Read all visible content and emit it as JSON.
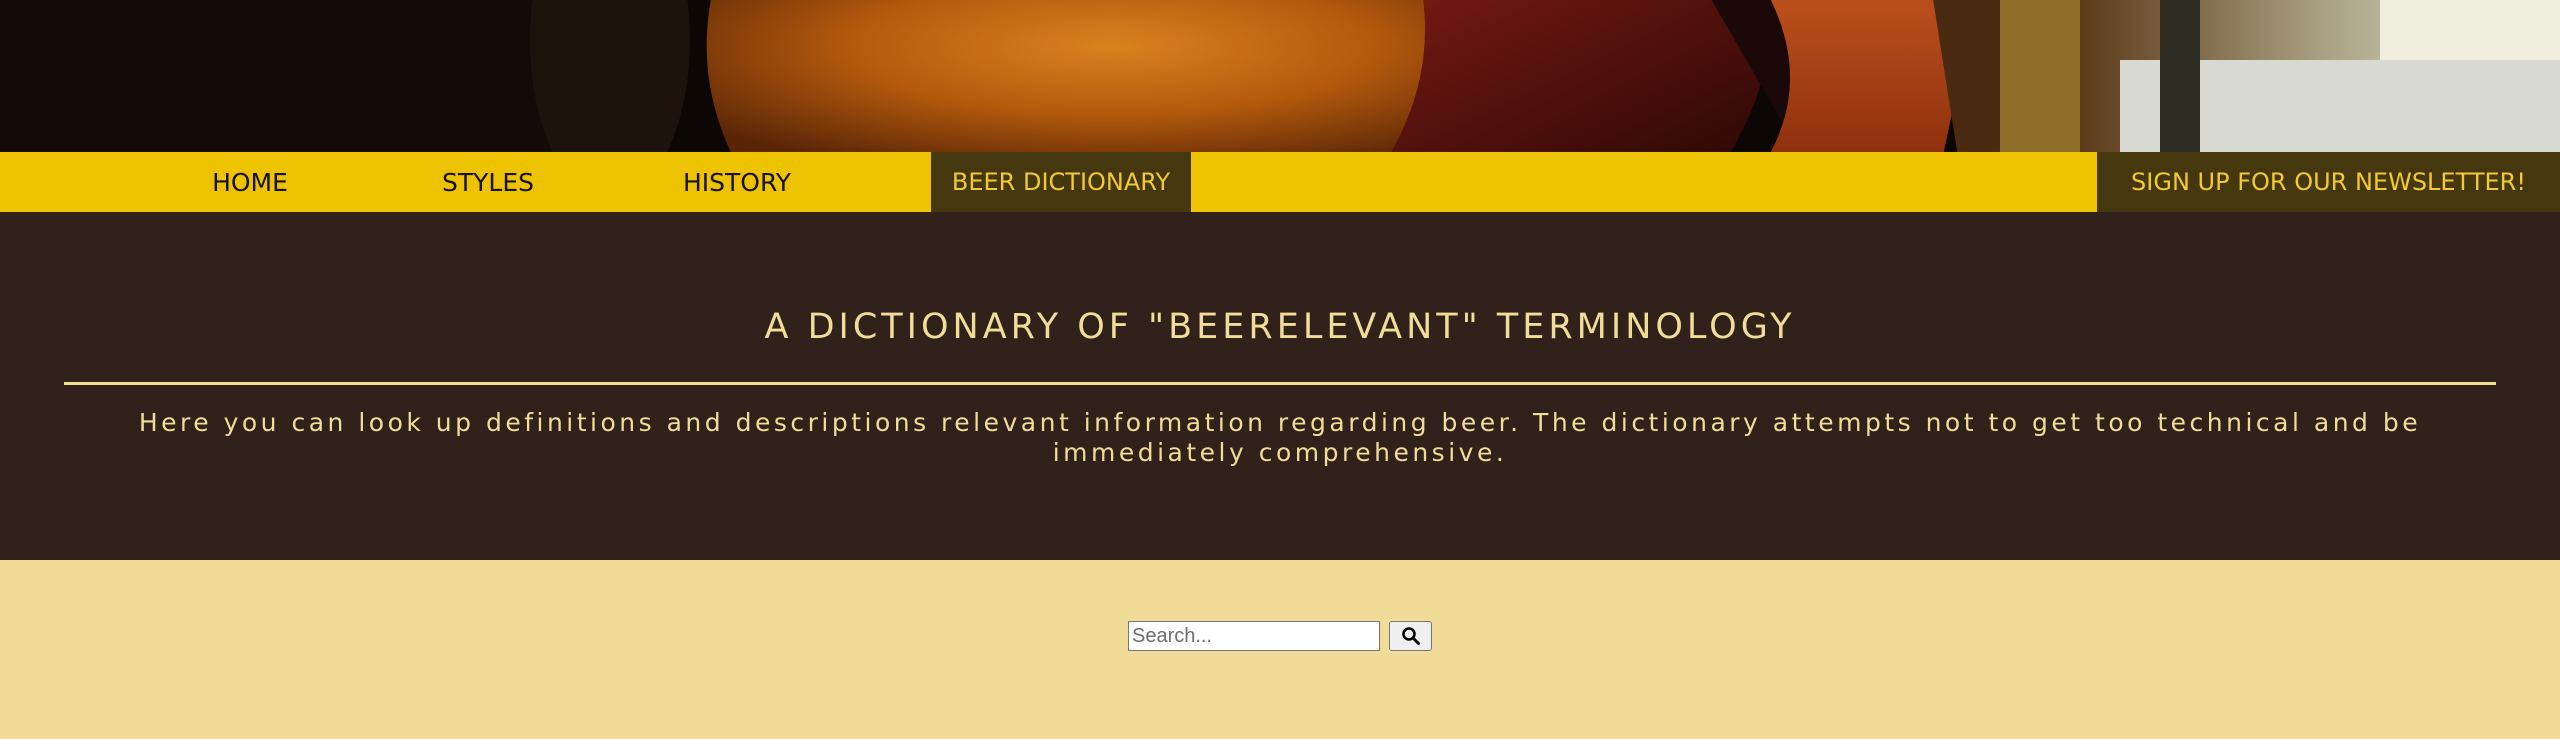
{
  "hero": {
    "image": "beer-glasses-banner"
  },
  "nav": {
    "items": [
      {
        "label": "HOME"
      },
      {
        "label": "STYLES"
      },
      {
        "label": "HISTORY"
      },
      {
        "label": "BEER DICTIONARY"
      }
    ],
    "active_index": 3,
    "newsletter_label": "SIGN UP FOR OUR NEWSLETTER!"
  },
  "intro": {
    "title": "A DICTIONARY OF \"BEERELEVANT\" TERMINOLOGY",
    "description": "Here you can look up definitions and descriptions relevant information regarding beer. The dictionary attempts not to get too technical and be immediately comprehensive."
  },
  "search": {
    "placeholder": "Search...",
    "value": "",
    "button_icon": "search-icon"
  },
  "colors": {
    "nav_bg": "#edc300",
    "nav_active_bg": "#45380f",
    "nav_active_text": "#f2ca2f",
    "intro_bg": "#30211a",
    "intro_text": "#f1dc98",
    "page_bg": "#f0dc96"
  }
}
